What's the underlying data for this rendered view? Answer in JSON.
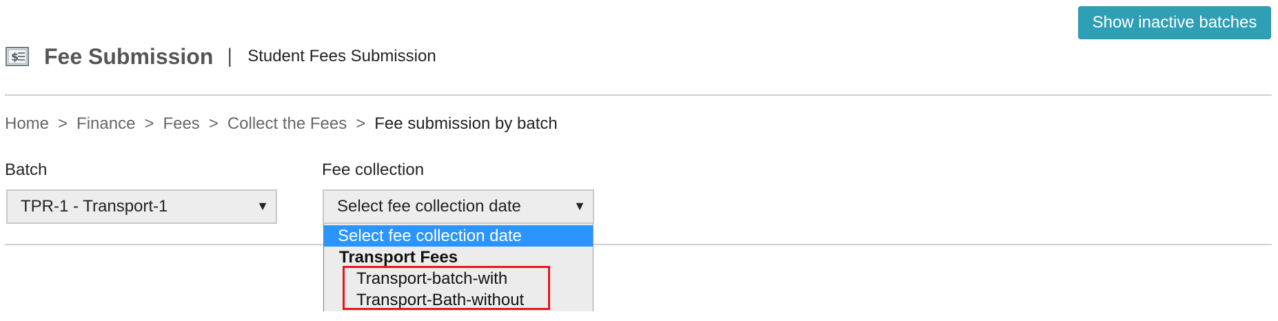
{
  "header": {
    "title": "Fee Submission",
    "separator": "|",
    "subtitle": "Student Fees Submission",
    "icon": "receipt-icon",
    "show_inactive_button": "Show inactive batches"
  },
  "breadcrumb": {
    "items": [
      "Home",
      "Finance",
      "Fees",
      "Collect the Fees"
    ],
    "separator": ">",
    "current": "Fee submission by batch"
  },
  "form": {
    "batch": {
      "label": "Batch",
      "value": "TPR-1 - Transport-1"
    },
    "fee_collection": {
      "label": "Fee collection",
      "value": "Select fee collection date",
      "dropdown_open": true,
      "options": {
        "placeholder": "Select fee collection date",
        "group_label": "Transport Fees",
        "items": [
          "Transport-batch-with",
          "Transport-Bath-without"
        ]
      }
    },
    "arrow_glyph": "▼"
  },
  "colors": {
    "button_bg": "#2f9fb5",
    "selected_option_bg": "#2b95ff",
    "highlight_border": "#e8141b"
  }
}
